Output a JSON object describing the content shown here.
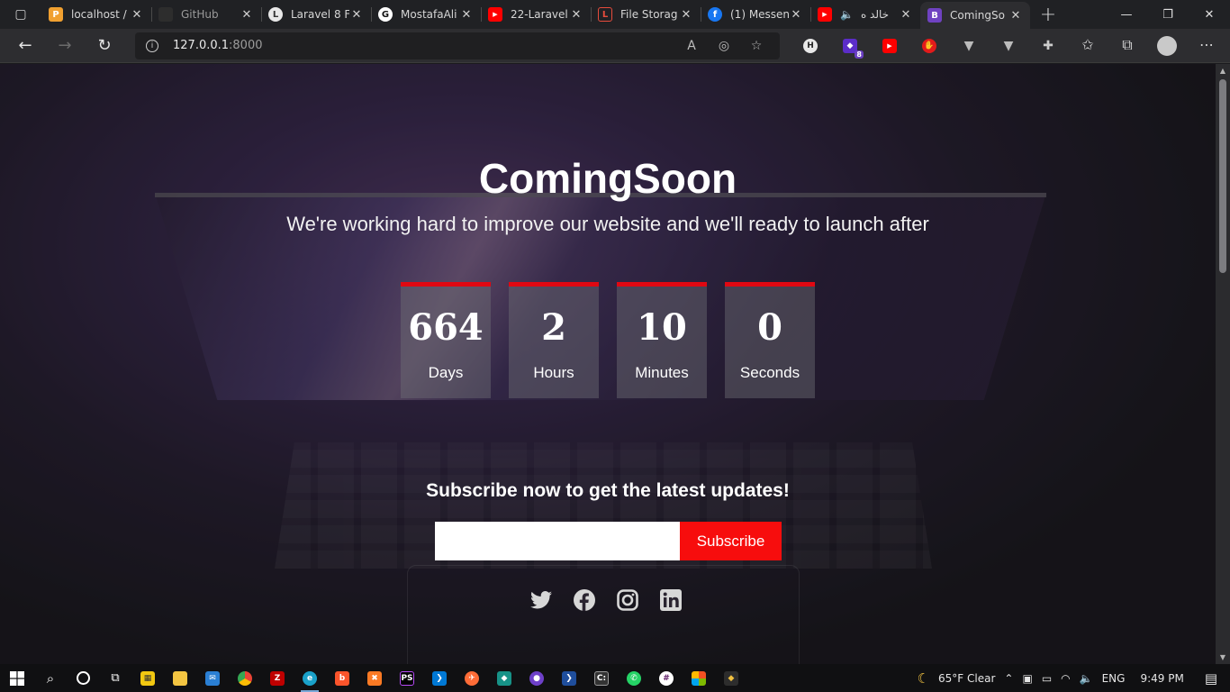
{
  "browser": {
    "tabs": [
      {
        "title": "localhost /",
        "color": "#f0a030",
        "glyph": "P"
      },
      {
        "title": "GitHub",
        "color": "#2d2d2d",
        "glyph": ""
      },
      {
        "title": "Laravel 8 F",
        "color": "#555555",
        "glyph": "L"
      },
      {
        "title": "MostafaAli",
        "color": "#ffffff",
        "glyph": "G"
      },
      {
        "title": "22-Laravel",
        "color": "#ff0000",
        "glyph": "▶"
      },
      {
        "title": "File Storag",
        "color": "#e74c3c",
        "glyph": "L"
      },
      {
        "title": "(1) Messen",
        "color": "#1877f2",
        "glyph": "f"
      },
      {
        "title": "خالد ه",
        "color": "#ff0000",
        "glyph": "▶"
      },
      {
        "title": "ComingSo",
        "color": "#6f42c1",
        "glyph": "B"
      }
    ],
    "url_host": "127.0.0.1",
    "url_port": ":8000",
    "extension_badge": "8"
  },
  "page": {
    "title": "ComingSoon",
    "subtitle": "We're working hard to improve our website and we'll ready to launch after",
    "countdown": [
      {
        "value": "664",
        "label": "Days"
      },
      {
        "value": "2",
        "label": "Hours"
      },
      {
        "value": "10",
        "label": "Minutes"
      },
      {
        "value": "0",
        "label": "Seconds"
      }
    ],
    "subscribe_heading": "Subscribe now to get the latest updates!",
    "email_value": "",
    "subscribe_button": "Subscribe",
    "social": [
      "twitter-icon",
      "facebook-icon",
      "instagram-icon",
      "linkedin-icon"
    ],
    "accent": "#e00812"
  },
  "taskbar": {
    "weather": "65°F  Clear",
    "language": "ENG",
    "time": "9:49 PM"
  }
}
